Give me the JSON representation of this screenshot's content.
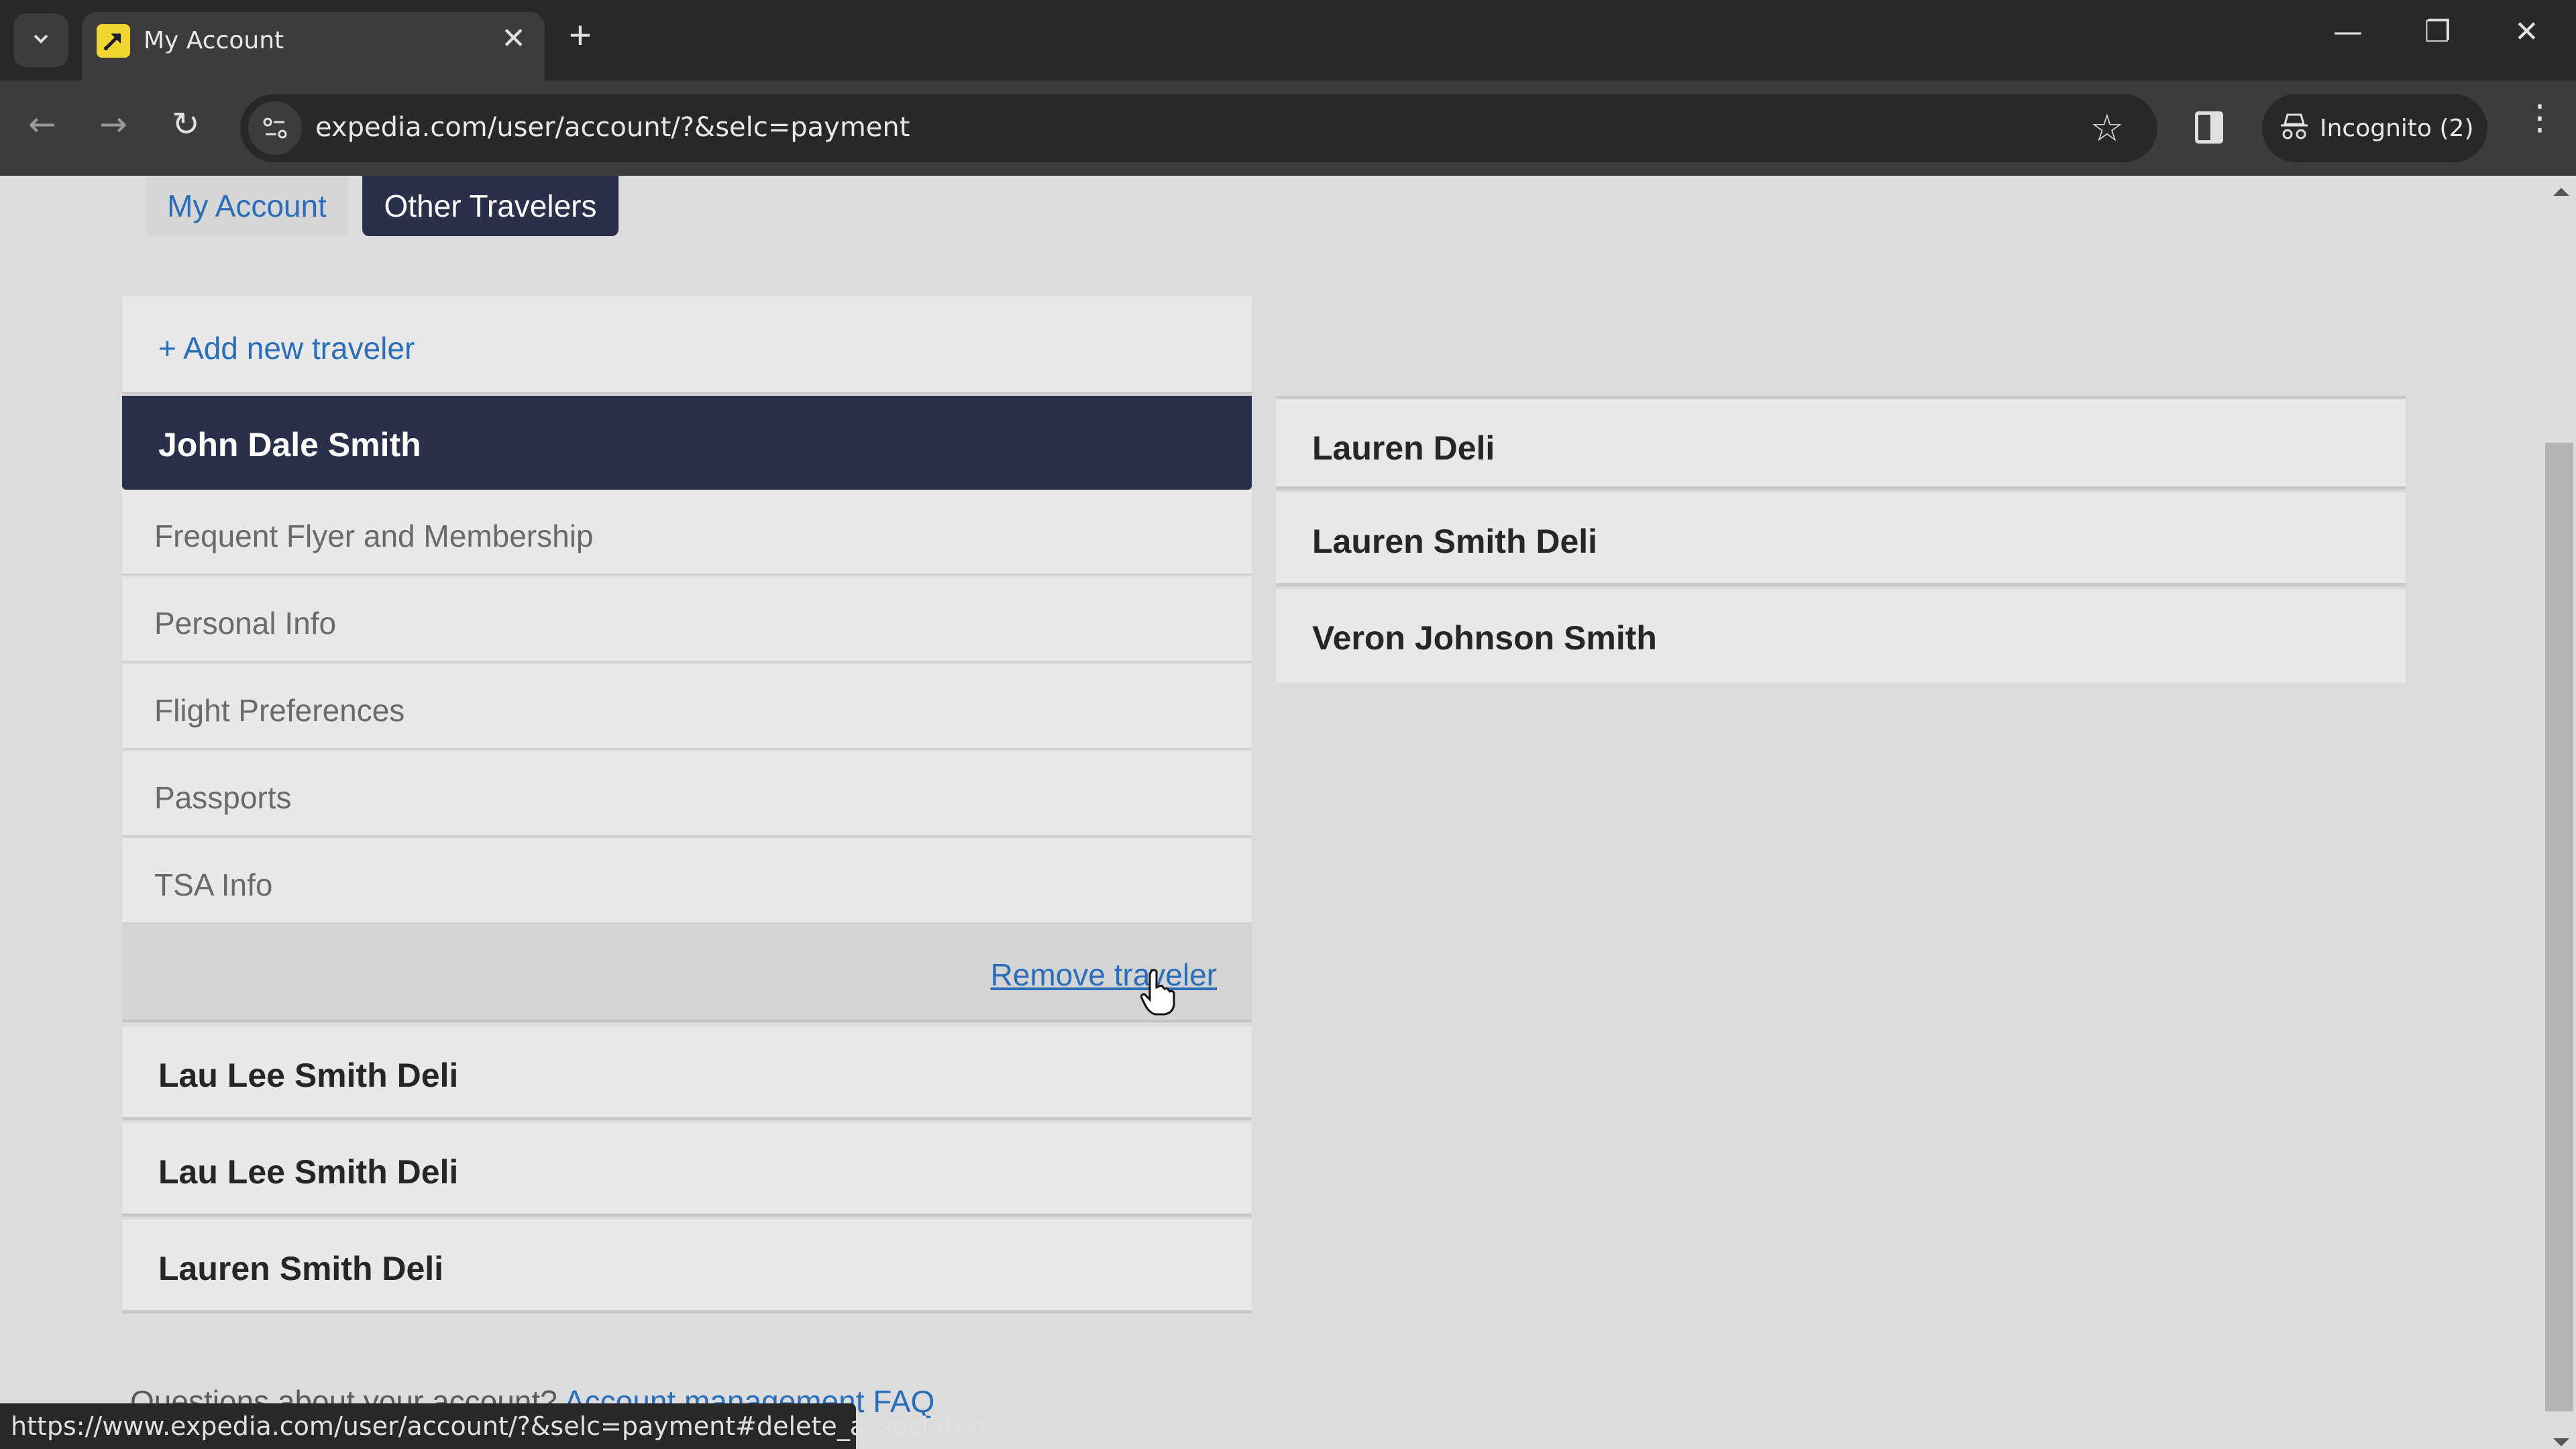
{
  "browser": {
    "tab_title": "My Account",
    "url": "expedia.com/user/account/?&selc=payment",
    "incognito_label": "Incognito (2)",
    "status_url": "https://www.expedia.com/user/account/?&selc=payment#delete_associated...",
    "brand_color": "#f2d630"
  },
  "account_tabs": [
    {
      "label": "My Account",
      "active": false
    },
    {
      "label": "Other Travelers",
      "active": true
    }
  ],
  "left_panel": {
    "add_traveler_label": "+ Add new traveler",
    "selected_traveler": "John Dale Smith",
    "sub_items": [
      "Frequent Flyer and Membership",
      "Personal Info",
      "Flight Preferences",
      "Passports",
      "TSA Info"
    ],
    "remove_label": "Remove traveler",
    "other_travelers": [
      "Lau Lee Smith Deli",
      "Lau Lee Smith Deli",
      "Lauren Smith Deli"
    ]
  },
  "right_panel": {
    "travelers": [
      "Lauren Deli",
      "Lauren Smith Deli",
      "Veron Johnson Smith"
    ]
  },
  "footer": {
    "question": "Questions about your account? ",
    "faq_link": "Account management FAQ"
  },
  "colors": {
    "accent_navy": "#2a3049",
    "link_blue": "#2a6ebb"
  }
}
